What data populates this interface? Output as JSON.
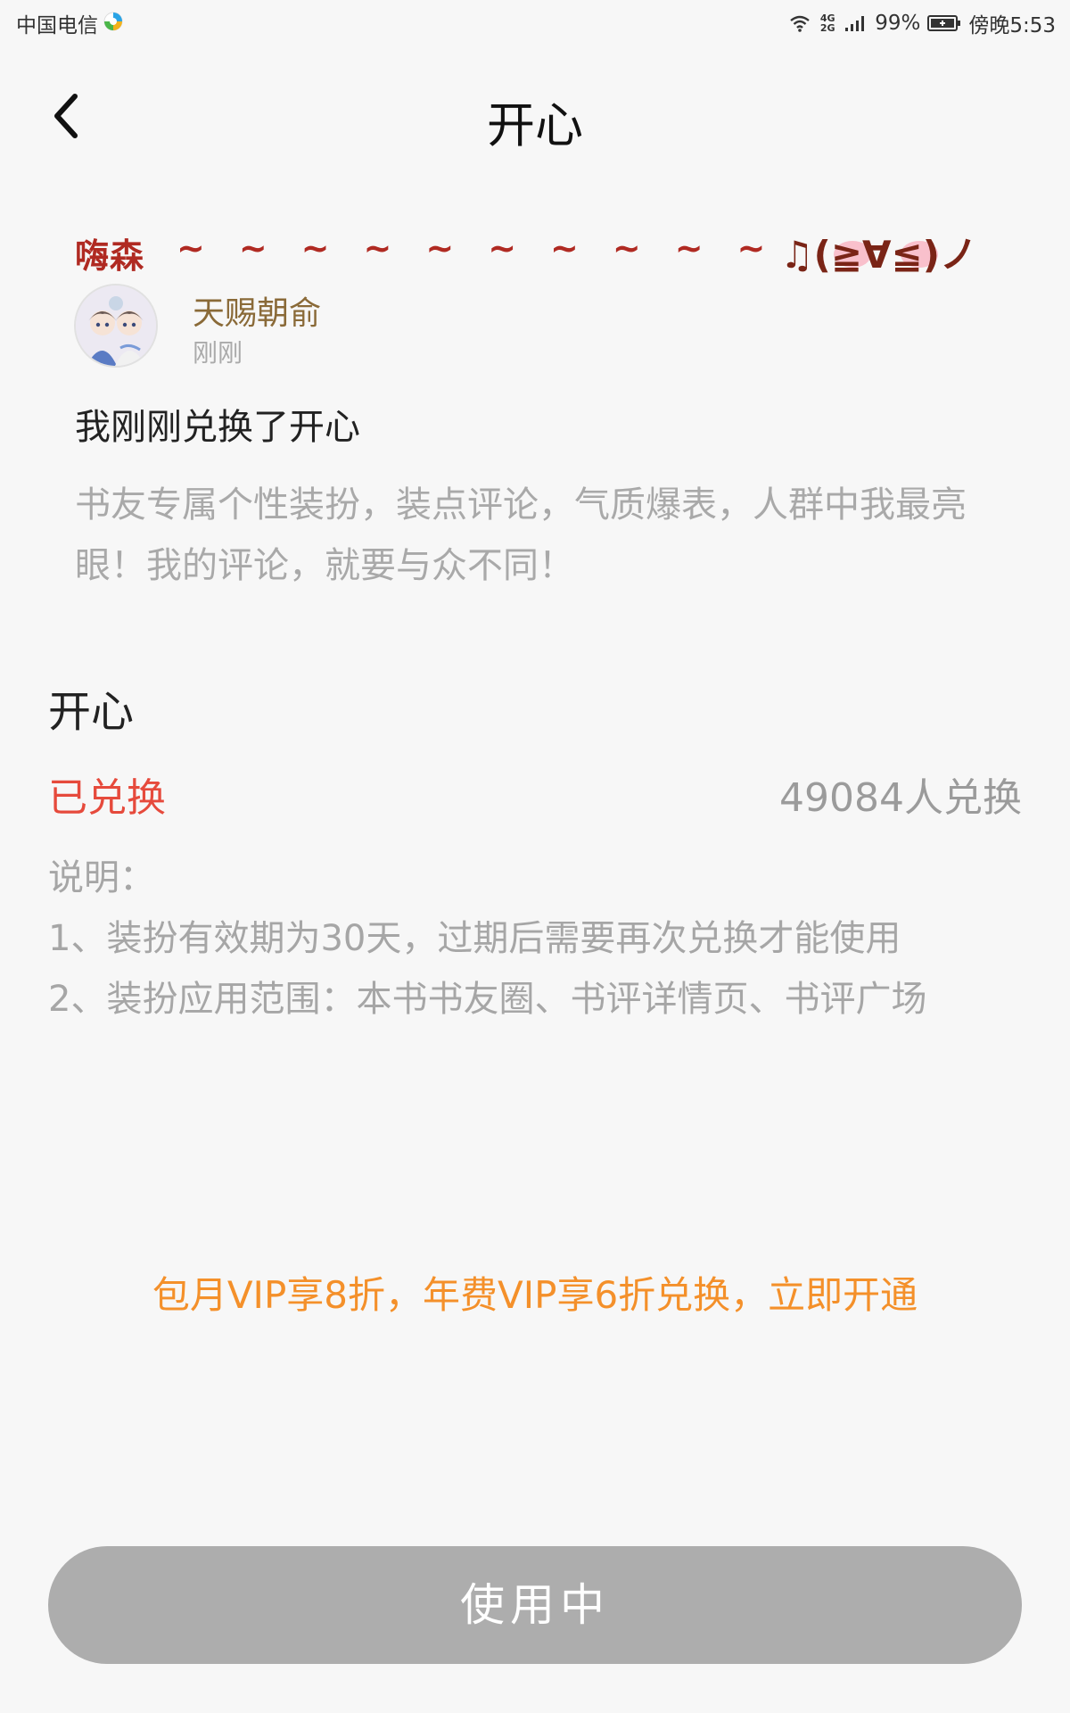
{
  "status_bar": {
    "carrier": "中国电信",
    "network": "4G 2G",
    "battery": "99%",
    "time": "傍晚5:53"
  },
  "nav": {
    "title": "开心",
    "back_icon": "chevron-left-icon"
  },
  "preview": {
    "banner_text": "嗨森",
    "banner_tildes": "~~~~~~~~~~",
    "banner_face": "♫(≧∀≦)ノ",
    "username": "天赐朝俞",
    "time": "刚刚",
    "title": "我刚刚兑换了开心",
    "description": "书友专属个性装扮，装点评论，气质爆表，人群中我最亮眼！我的评论，就要与众不同！"
  },
  "item": {
    "name": "开心",
    "status": "已兑换",
    "exchange_count": "49084人兑换"
  },
  "explanation": {
    "heading": "说明：",
    "line1": "1、装扮有效期为30天，过期后需要再次兑换才能使用",
    "line2": "2、装扮应用范围：本书书友圈、书评详情页、书评广场"
  },
  "vip_promo": "包月VIP享8折，年费VIP享6折兑换，立即开通",
  "use_button": "使用中",
  "colors": {
    "accent_red": "#e64a3c",
    "promo_orange": "#f4902a",
    "username_brown": "#8a6a38",
    "banner_red": "#b02a22",
    "button_gray": "#adadad"
  }
}
